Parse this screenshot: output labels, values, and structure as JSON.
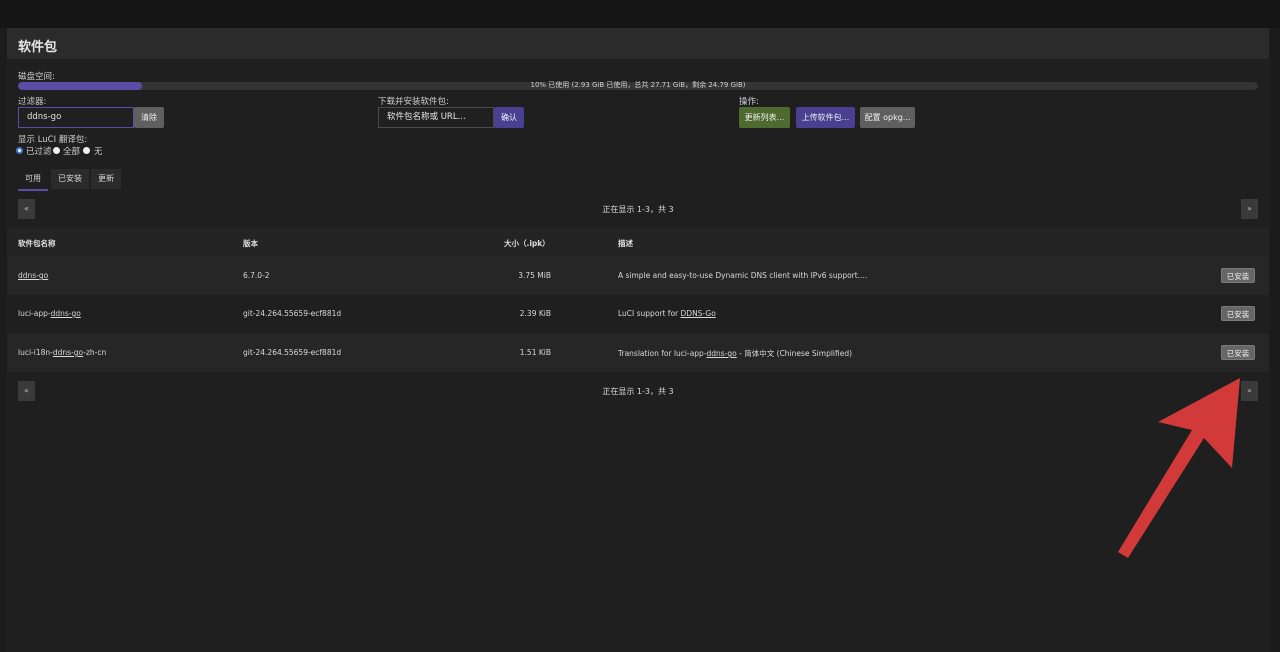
{
  "panel": {
    "title": "软件包"
  },
  "disk": {
    "label": "磁盘空间:",
    "usage_percent": 10,
    "usage_text": "10% 已使用 (2.93 GiB 已使用，总共 27.71 GiB，剩余 24.79 GiB)"
  },
  "filter": {
    "label": "过滤器:",
    "value": "ddns-go",
    "clear_label": "清除"
  },
  "download": {
    "label": "下载并安装软件包:",
    "placeholder": "软件包名称或 URL...",
    "confirm_label": "确认"
  },
  "actions": {
    "label": "操作:",
    "update_lists_label": "更新列表...",
    "upload_label": "上传软件包...",
    "configure_label": "配置 opkg..."
  },
  "luci_translation": {
    "label": "显示 LuCI 翻译包:",
    "options": [
      "已过滤",
      "全部",
      "无"
    ],
    "selected": "已过滤"
  },
  "tabs": [
    {
      "label": "可用"
    },
    {
      "label": "已安装"
    },
    {
      "label": "更新"
    }
  ],
  "pager": {
    "prev": "«",
    "next": "»",
    "status": "正在显示 1-3，共 3"
  },
  "table": {
    "headers": {
      "name": "软件包名称",
      "version": "版本",
      "size": "大小（.ipk）",
      "description": "描述"
    },
    "rows": [
      {
        "name_prefix": "",
        "name_link": "ddns-go",
        "name_suffix": "",
        "version": "6.7.0-2",
        "size": "3.75 MiB",
        "desc_prefix": "A simple and easy-to-use Dynamic DNS client with IPv6 support....",
        "desc_link": "",
        "desc_suffix": "",
        "action": "已安装"
      },
      {
        "name_prefix": "luci-app-",
        "name_link": "ddns-go",
        "name_suffix": "",
        "version": "git-24.264.55659-ecf881d",
        "size": "2.39 KiB",
        "desc_prefix": "LuCI support for ",
        "desc_link": "DDNS-Go",
        "desc_suffix": "",
        "action": "已安装"
      },
      {
        "name_prefix": "luci-i18n-",
        "name_link": "ddns-go",
        "name_suffix": "-zh-cn",
        "version": "git-24.264.55659-ecf881d",
        "size": "1.51 KiB",
        "desc_prefix": "Translation for luci-app-",
        "desc_link": "ddns-go",
        "desc_suffix": " - 简体中文 (Chinese Simplified)",
        "action": "已安装"
      }
    ]
  },
  "colors": {
    "accent": "#5b4ca6",
    "annotation_arrow": "#d23a3a"
  }
}
